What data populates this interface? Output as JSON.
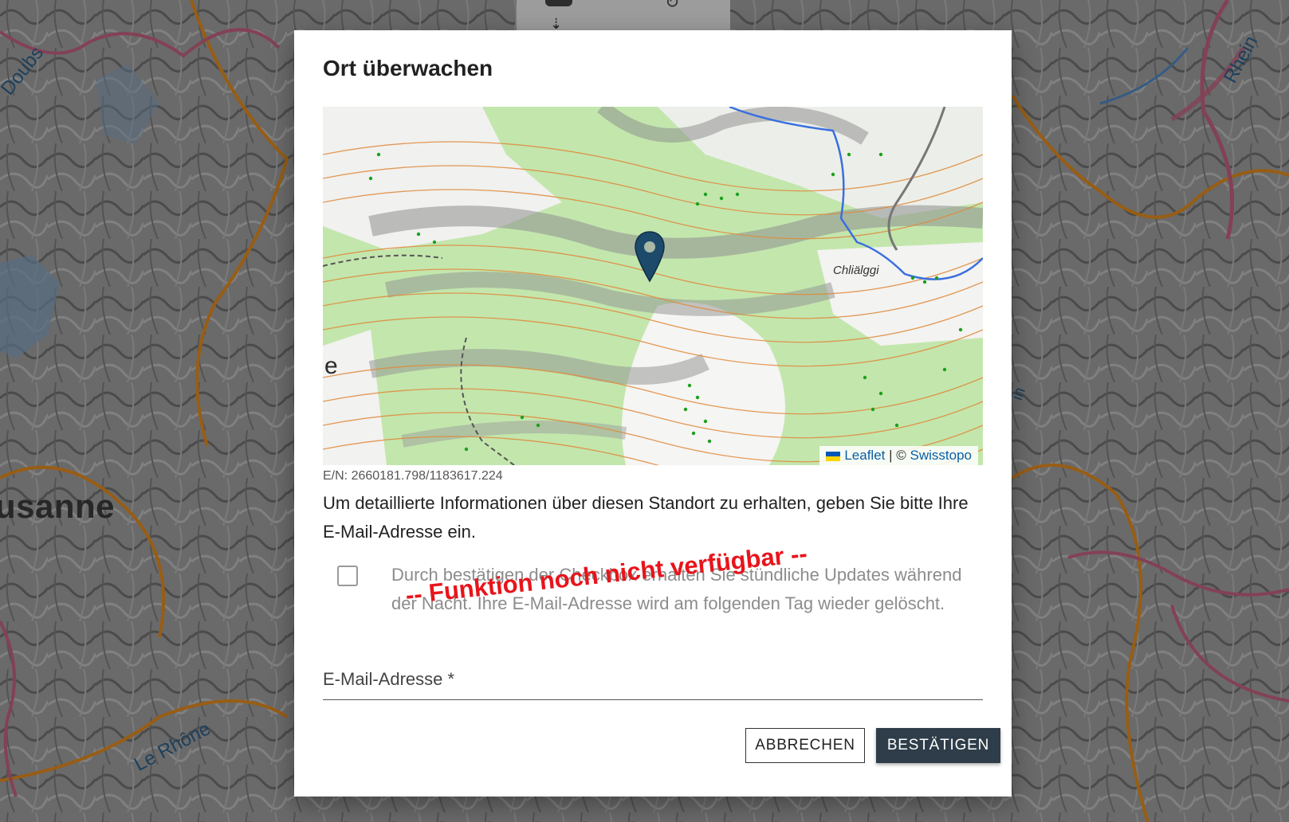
{
  "background_map": {
    "labels": {
      "city": "usanne",
      "river_doubs": "Doubs",
      "river_rhone": "Le Rhône",
      "river_rhein": "Rhein",
      "river_partial": "in"
    }
  },
  "dialog": {
    "title": "Ort überwachen",
    "map": {
      "place_label": "Chliälggi",
      "edge_label": "e",
      "attribution": {
        "leaflet": "Leaflet",
        "separator": " | © ",
        "provider": "Swisstopo"
      }
    },
    "coordinates": "E/N: 2660181.798/1183617.224",
    "info_text": "Um detaillierte Informationen über diesen Standort zu erhalten, geben Sie bitte Ihre E-Mail-Adresse ein.",
    "hourly_updates": {
      "checked": false,
      "label": "Durch bestätigen der Checkbox erhalten Sie stündliche Updates während der Nacht. Ihre E-Mail-Adresse wird am folgenden Tag wieder gelöscht."
    },
    "unavailable_notice": "-- Funktion noch nicht verfügbar --",
    "email_field": {
      "label": "E-Mail-Adresse *",
      "value": ""
    },
    "buttons": {
      "cancel": "ABBRECHEN",
      "confirm": "BESTÄTIGEN"
    },
    "colors": {
      "confirm_button": "#2e3d49",
      "unavailable_notice": "#e8141b",
      "link": "#0b5fa8"
    }
  }
}
